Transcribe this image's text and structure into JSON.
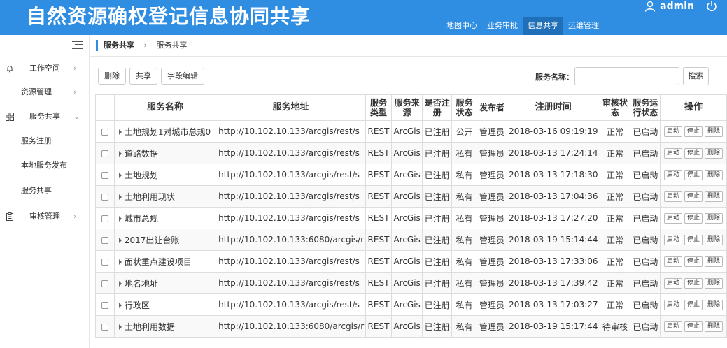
{
  "header": {
    "title": "自然资源确权登记信息协同共享",
    "nav": [
      {
        "label": "地图中心"
      },
      {
        "label": "业务审批"
      },
      {
        "label": "信息共享",
        "active": true
      },
      {
        "label": "运维管理"
      }
    ],
    "user": "admin",
    "icons": [
      "user-icon",
      "power-icon"
    ]
  },
  "sidebar": {
    "items": [
      {
        "label": "工作空间",
        "icon": "bell-icon",
        "arrow": "›"
      },
      {
        "label": "资源管理",
        "icon": "",
        "arrow": "›"
      },
      {
        "label": "服务共享",
        "icon": "grid-icon",
        "arrow": "⌄"
      },
      {
        "label": "服务注册"
      },
      {
        "label": "本地服务发布"
      },
      {
        "label": "服务共享"
      },
      {
        "label": "审核管理",
        "icon": "clipboard-icon",
        "arrow": "›"
      }
    ]
  },
  "breadcrumb": {
    "parent": "服务共享",
    "sep": "›",
    "current": "服务共享"
  },
  "toolbar": {
    "delete": "删除",
    "share": "共享",
    "field_edit": "字段编辑"
  },
  "search": {
    "label": "服务名称：",
    "value": "",
    "button": "搜索"
  },
  "table": {
    "headers": [
      "服务名称",
      "服务地址",
      "服务类型",
      "服务来源",
      "是否注册",
      "服务状态",
      "发布者",
      "注册时间",
      "审核状态",
      "服务运行状态",
      "操作"
    ],
    "op_labels": {
      "start": "启动",
      "stop": "停止",
      "delete": "删除"
    },
    "rows": [
      {
        "name": "土地规划1对城市总规0",
        "url": "http://10.102.10.133/arcgis/rest/s",
        "type": "REST",
        "source": "ArcGis",
        "reg": "已注册",
        "vis": "公开",
        "pub": "管理员",
        "time": "2018-03-16 09:19:19",
        "audit": "正常",
        "run": "已启动"
      },
      {
        "name": "道路数据",
        "url": "http://10.102.10.133/arcgis/rest/s",
        "type": "REST",
        "source": "ArcGis",
        "reg": "已注册",
        "vis": "私有",
        "pub": "管理员",
        "time": "2018-03-13 17:24:14",
        "audit": "正常",
        "run": "已启动"
      },
      {
        "name": "土地规划",
        "url": "http://10.102.10.133/arcgis/rest/s",
        "type": "REST",
        "source": "ArcGis",
        "reg": "已注册",
        "vis": "私有",
        "pub": "管理员",
        "time": "2018-03-13 17:18:30",
        "audit": "正常",
        "run": "已启动"
      },
      {
        "name": "土地利用现状",
        "url": "http://10.102.10.133/arcgis/rest/s",
        "type": "REST",
        "source": "ArcGis",
        "reg": "已注册",
        "vis": "私有",
        "pub": "管理员",
        "time": "2018-03-13 17:04:36",
        "audit": "正常",
        "run": "已启动"
      },
      {
        "name": "城市总规",
        "url": "http://10.102.10.133/arcgis/rest/s",
        "type": "REST",
        "source": "ArcGis",
        "reg": "已注册",
        "vis": "私有",
        "pub": "管理员",
        "time": "2018-03-13 17:27:20",
        "audit": "正常",
        "run": "已启动"
      },
      {
        "name": "2017出让台账",
        "url": "http://10.102.10.133:6080/arcgis/r",
        "type": "REST",
        "source": "ArcGis",
        "reg": "已注册",
        "vis": "私有",
        "pub": "管理员",
        "time": "2018-03-19 15:14:44",
        "audit": "正常",
        "run": "已启动"
      },
      {
        "name": "面状重点建设项目",
        "url": "http://10.102.10.133/arcgis/rest/s",
        "type": "REST",
        "source": "ArcGis",
        "reg": "已注册",
        "vis": "私有",
        "pub": "管理员",
        "time": "2018-03-13 17:33:06",
        "audit": "正常",
        "run": "已启动"
      },
      {
        "name": "地名地址",
        "url": "http://10.102.10.133/arcgis/rest/s",
        "type": "REST",
        "source": "ArcGis",
        "reg": "已注册",
        "vis": "私有",
        "pub": "管理员",
        "time": "2018-03-13 17:39:42",
        "audit": "正常",
        "run": "已启动"
      },
      {
        "name": "行政区",
        "url": "http://10.102.10.133/arcgis/rest/s",
        "type": "REST",
        "source": "ArcGis",
        "reg": "已注册",
        "vis": "私有",
        "pub": "管理员",
        "time": "2018-03-13 17:03:27",
        "audit": "正常",
        "run": "已启动"
      },
      {
        "name": "土地利用数据",
        "url": "http://10.102.10.133:6080/arcgis/r",
        "type": "REST",
        "source": "ArcGis",
        "reg": "已注册",
        "vis": "私有",
        "pub": "管理员",
        "time": "2018-03-19 15:17:44",
        "audit": "待审核",
        "run": "已启动"
      }
    ]
  }
}
